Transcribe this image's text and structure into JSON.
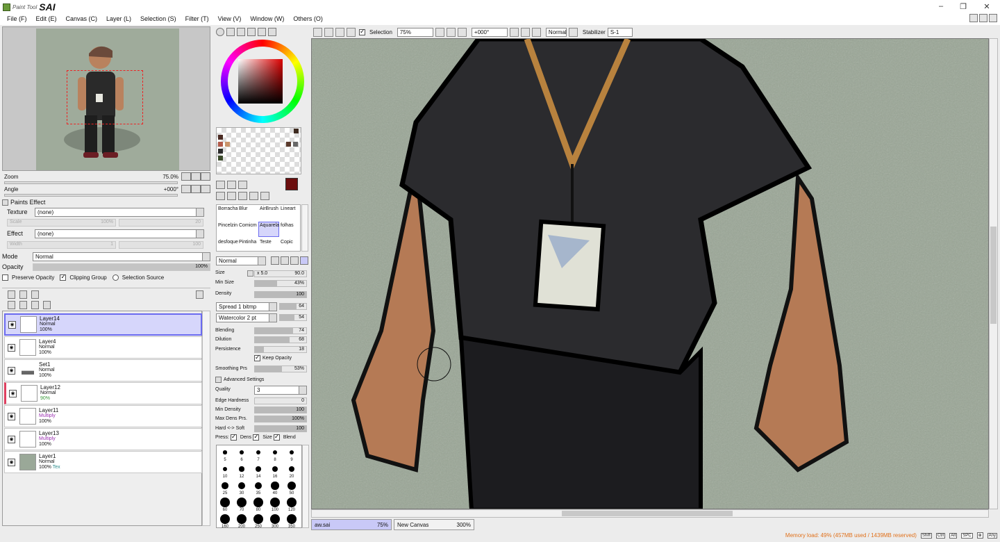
{
  "app": {
    "brand": "Paint Tool",
    "name": "SAI"
  },
  "menu": [
    "File (F)",
    "Edit (E)",
    "Canvas (C)",
    "Layer (L)",
    "Selection (S)",
    "Filter (T)",
    "View (V)",
    "Window (W)",
    "Others (O)"
  ],
  "navigator": {
    "zoom_label": "Zoom",
    "zoom_value": "75.0%",
    "angle_label": "Angle",
    "angle_value": "+000°"
  },
  "paints_effect": {
    "header": "Paints Effect",
    "texture_label": "Texture",
    "texture_value": "(none)",
    "scale_label": "Scale",
    "scale_value": "100%",
    "scale_num": "20",
    "effect_label": "Effect",
    "effect_value": "(none)",
    "width_label": "Width",
    "width_value": "1",
    "width_num": "100"
  },
  "layer_props": {
    "mode_label": "Mode",
    "mode_value": "Normal",
    "opacity_label": "Opacity",
    "opacity_value": "100%",
    "preserve_opacity": "Preserve Opacity",
    "clipping_group": "Clipping Group",
    "selection_source": "Selection Source"
  },
  "layers": [
    {
      "name": "Layer14",
      "mode": "Normal",
      "opacity": "100%",
      "selected": true,
      "mode_color": "#111111"
    },
    {
      "name": "Layer4",
      "mode": "Normal",
      "opacity": "100%",
      "selected": false,
      "mode_color": "#111111"
    },
    {
      "name": "Set1",
      "mode": "Normal",
      "opacity": "100%",
      "selected": false,
      "mode_color": "#111111"
    },
    {
      "name": "Layer12",
      "mode": "Normal",
      "opacity": "90%",
      "selected": false,
      "mode_color": "#111111"
    },
    {
      "name": "Layer11",
      "mode": "Multiply",
      "opacity": "100%",
      "selected": false,
      "mode_color": "#9a2fb0"
    },
    {
      "name": "Layer13",
      "mode": "Multiply",
      "opacity": "100%",
      "selected": false,
      "mode_color": "#9a2fb0"
    },
    {
      "name": "Layer1",
      "mode": "Normal",
      "opacity": "100%",
      "extra": "Tex",
      "selected": false,
      "mode_color": "#111111"
    }
  ],
  "tools": {
    "names": [
      "Borracha",
      "Blur",
      "AirBrush",
      "Lineart",
      "Pincelzin",
      "Comicm",
      "Aquarela",
      "folhas",
      "desfoque",
      "Pintinha",
      "Teste",
      "Copic"
    ],
    "blend_mode": "Normal"
  },
  "brush": {
    "size_label": "Size",
    "size_mult": "x 5.0",
    "size_value": "90.0",
    "min_size_label": "Min Size",
    "min_size_value": "43%",
    "density_label": "Density",
    "density_value": "100",
    "spread_label": "Spread 1 bitmp",
    "spread_value": "64",
    "watercolor_label": "Watercolor 2 pt",
    "watercolor_value": "54",
    "blending_label": "Blending",
    "blending_value": "74",
    "dilution_label": "Dilution",
    "dilution_value": "68",
    "persistence_label": "Persistence",
    "persistence_value": "18",
    "keep_opacity": "Keep Opacity",
    "smoothing_label": "Smoothing Prs",
    "smoothing_value": "53%",
    "advanced": "Advanced Settings",
    "quality_label": "Quality",
    "quality_value": "3",
    "edge_label": "Edge Hardness",
    "edge_value": "0",
    "min_density_label": "Min Density",
    "min_density_value": "100",
    "max_dens_label": "Max Dens Prs.",
    "max_dens_value": "100%",
    "hard_soft_label": "Hard <-> Soft",
    "hard_soft_value": "100",
    "press_label": "Press:",
    "press_dens": "Dens",
    "press_size": "Size",
    "press_blend": "Blend"
  },
  "brush_sizes": [
    "5",
    "6",
    "7",
    "8",
    "9",
    "10",
    "12",
    "14",
    "16",
    "20",
    "25",
    "30",
    "35",
    "40",
    "50",
    "60",
    "70",
    "80",
    "100",
    "120",
    "160",
    "200",
    "250",
    "300",
    "350"
  ],
  "toolbar": {
    "selection_label": "Selection",
    "zoom_value": "75%",
    "angle_value": "+000°",
    "mode_value": "Normal",
    "stabilizer_label": "Stabilizer",
    "stabilizer_value": "S-1"
  },
  "tabs": [
    {
      "name": "aw.sai",
      "zoom": "75%",
      "active": true
    },
    {
      "name": "New Canvas",
      "zoom": "300%",
      "active": false
    }
  ],
  "status": {
    "memory": "Memory load: 49% (457MB used / 1439MB reserved)",
    "keys": [
      "Shift",
      "Ctrl",
      "Alt",
      "SPC",
      "⊕",
      "Any"
    ]
  }
}
